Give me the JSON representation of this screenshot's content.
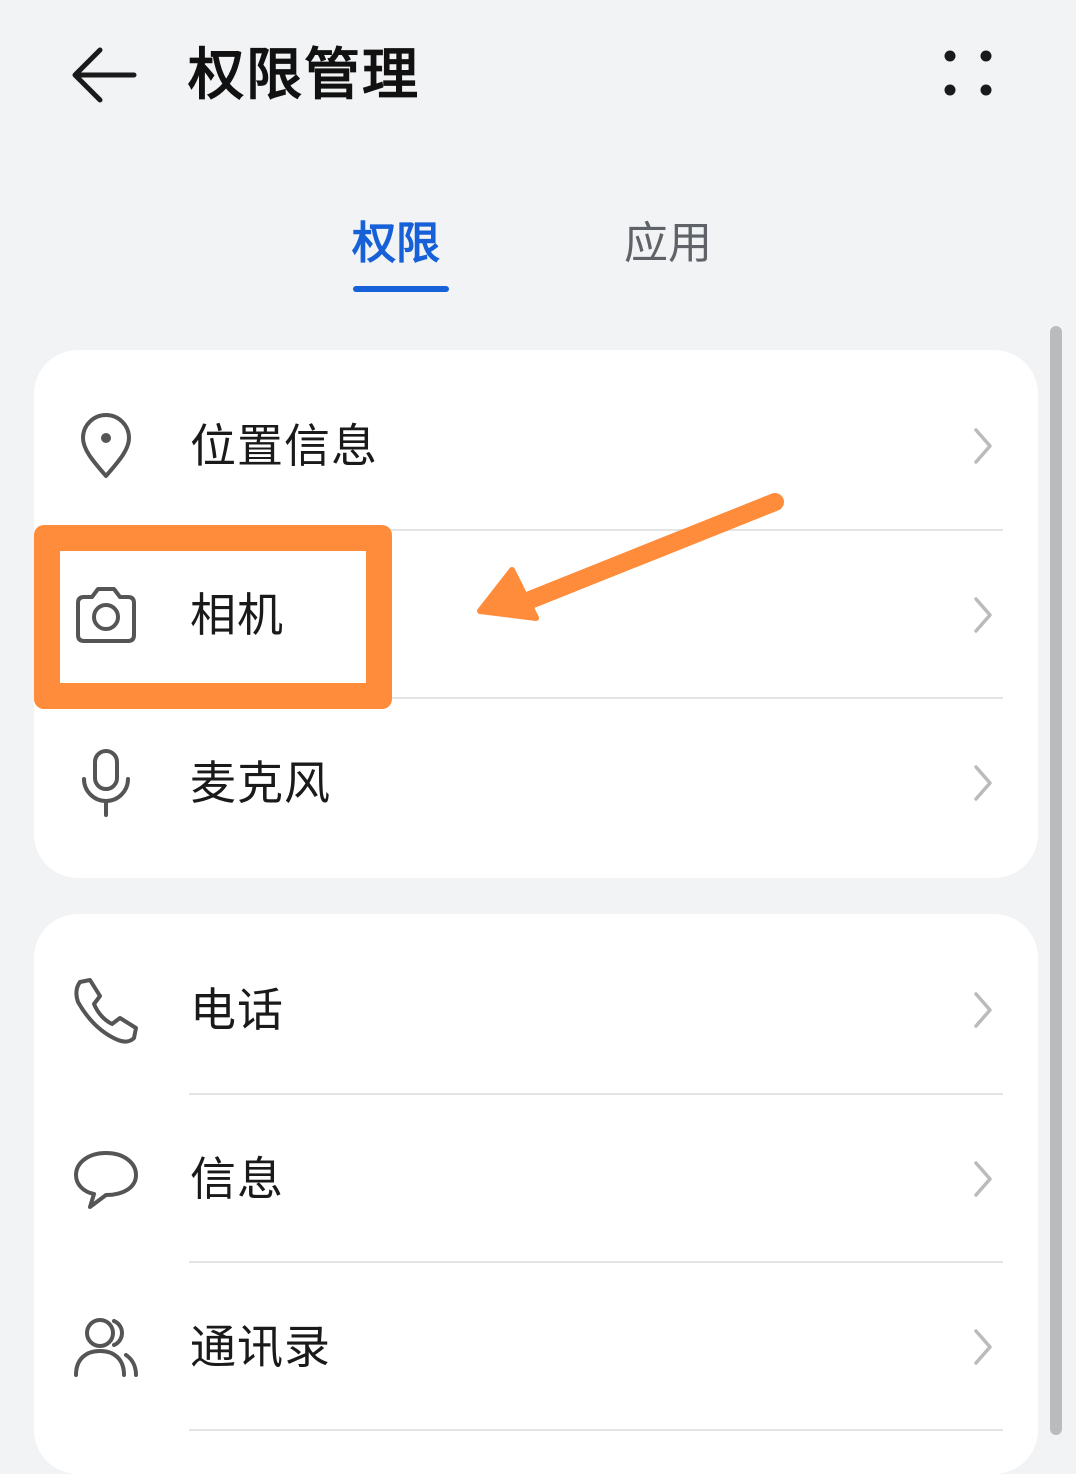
{
  "header": {
    "title": "权限管理",
    "back_icon": "back-arrow-icon",
    "more_icon": "more-dots-icon"
  },
  "tabs": [
    {
      "label": "权限",
      "active": true
    },
    {
      "label": "应用",
      "active": false
    }
  ],
  "colors": {
    "accent": "#1660d8",
    "annotation": "#ff8c3a",
    "background": "#f1f3f5",
    "card": "#ffffff"
  },
  "groups": [
    {
      "items": [
        {
          "label": "位置信息",
          "icon": "location-pin-icon"
        },
        {
          "label": "相机",
          "icon": "camera-icon",
          "highlighted": true
        },
        {
          "label": "麦克风",
          "icon": "microphone-icon"
        }
      ]
    },
    {
      "items": [
        {
          "label": "电话",
          "icon": "phone-icon"
        },
        {
          "label": "信息",
          "icon": "message-bubble-icon"
        },
        {
          "label": "通讯录",
          "icon": "contacts-icon"
        }
      ]
    }
  ]
}
